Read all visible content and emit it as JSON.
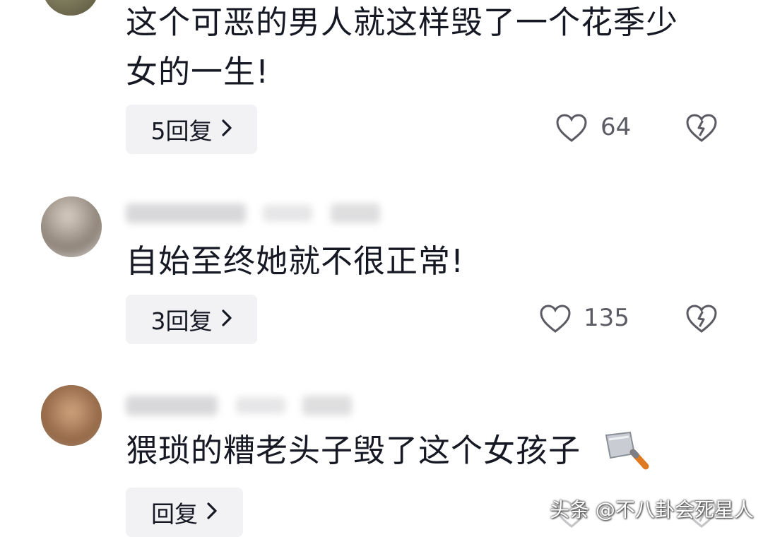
{
  "comments": [
    {
      "text": "这个可恶的男人就这样毁了一个花季少",
      "text_line2": "女的一生!",
      "reply_label": "5回复",
      "like_count": "64"
    },
    {
      "text": "自始至终她就不很正常!",
      "reply_label": "3回复",
      "like_count": "135"
    },
    {
      "text": "猥琐的糟老头子毁了这个女孩子",
      "reply_label": "回复"
    }
  ],
  "icons": {
    "like": "heart-icon",
    "dislike": "broken-heart-icon",
    "chevron": "chevron-right-icon",
    "emoji": "cleaver-emoji-icon"
  },
  "watermark": "头条 @不八卦会死星人",
  "colors": {
    "text": "#161823",
    "reply_bg": "#f2f2f4",
    "icon": "#5b5b64"
  }
}
